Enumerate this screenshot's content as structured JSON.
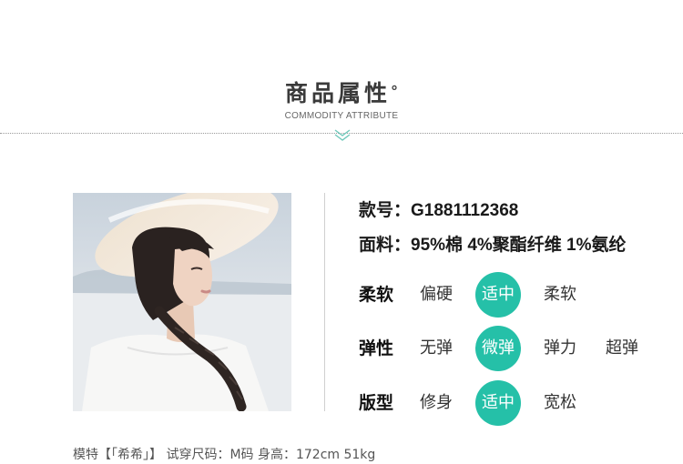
{
  "header": {
    "title": "商品属性",
    "title_mark": "°",
    "subtitle": "COMMODITY ATTRIBUTE"
  },
  "product": {
    "style_label": "款号：",
    "style_value": "G1881112368",
    "fabric_label": "面料：",
    "fabric_value": "95%棉 4%聚酯纤维 1%氨纶"
  },
  "attributes": [
    {
      "label": "柔软",
      "options": [
        "偏硬",
        "适中",
        "柔软"
      ],
      "selected": "适中"
    },
    {
      "label": "弹性",
      "options": [
        "无弹",
        "微弹",
        "弹力",
        "超弹"
      ],
      "selected": "微弹"
    },
    {
      "label": "版型",
      "options": [
        "修身",
        "适中",
        "宽松"
      ],
      "selected": "适中"
    }
  ],
  "footer": {
    "text": "模特【「希希」】 试穿尺码：M码 身高：172cm 51kg"
  },
  "colors": {
    "accent": "#25c0a8",
    "divider": "#9a9a9a"
  },
  "image": {
    "description_name": "model-photo"
  }
}
